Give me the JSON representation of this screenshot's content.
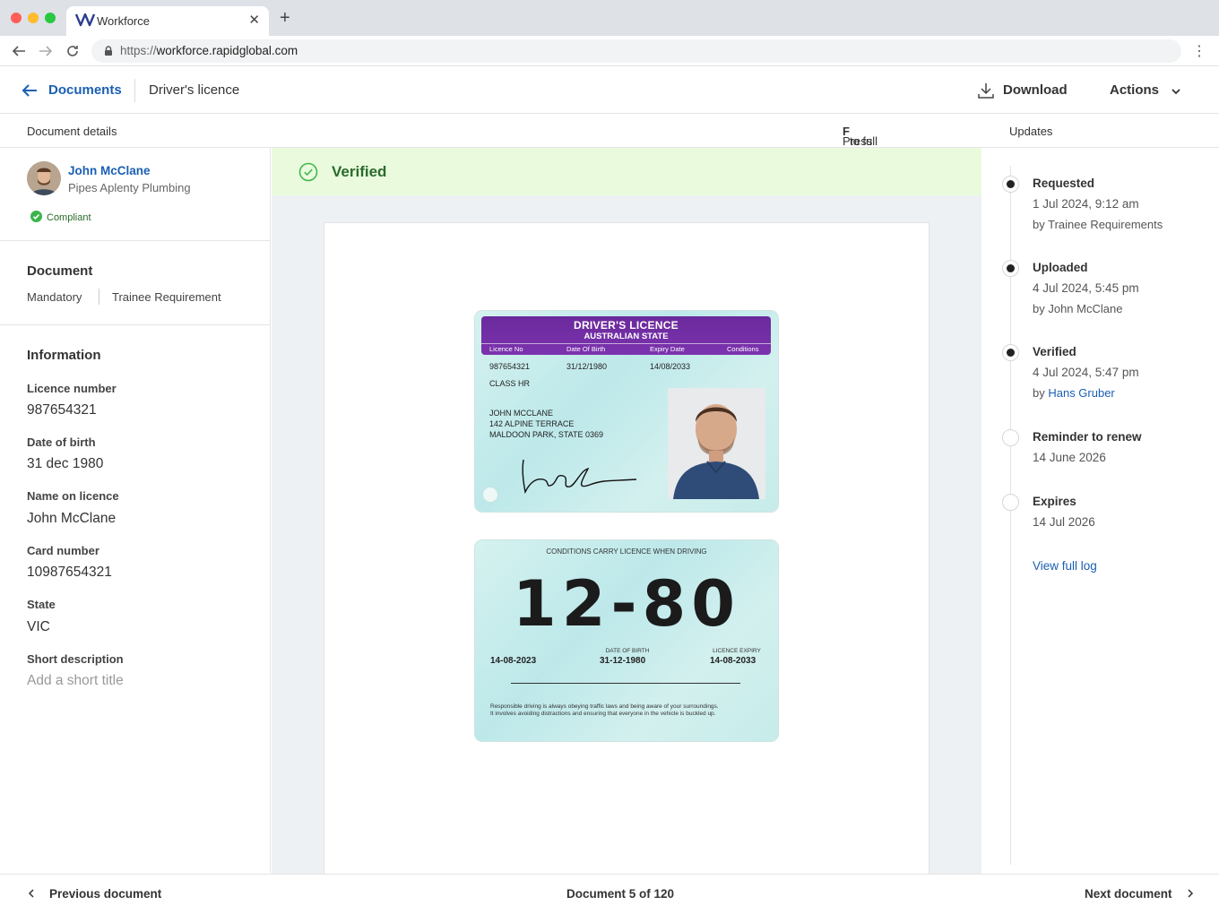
{
  "browser": {
    "tab_title": "Workforce",
    "url_proto": "https://",
    "url_host": "workforce.rapidglobal.com"
  },
  "header": {
    "back_label": "Documents",
    "current": "Driver's licence",
    "download_label": "Download",
    "actions_label": "Actions"
  },
  "subheader": {
    "left": "Document details",
    "hint_pre": "Press ",
    "hint_key": "F",
    "hint_post": " to full screen",
    "right": "Updates"
  },
  "person": {
    "name": "John McClane",
    "company": "Pipes Aplenty Plumbing",
    "status": "Compliant"
  },
  "document": {
    "title": "Document",
    "tag1": "Mandatory",
    "tag2": "Trainee Requirement"
  },
  "information": {
    "title": "Information",
    "fields": [
      {
        "label": "Licence number",
        "value": "987654321"
      },
      {
        "label": "Date of birth",
        "value": "31 dec 1980"
      },
      {
        "label": "Name on licence",
        "value": "John McClane"
      },
      {
        "label": "Card number",
        "value": "10987654321"
      },
      {
        "label": "State",
        "value": "VIC"
      },
      {
        "label": "Short description",
        "value": "Add a short title"
      }
    ]
  },
  "status_banner": "Verified",
  "card_front": {
    "title": "DRIVER'S LICENCE",
    "subtitle": "AUSTRALIAN STATE",
    "col_licence": "Licence No",
    "col_dob": "Date Of Birth",
    "col_expiry": "Expiry Date",
    "col_conditions": "Conditions",
    "licence_no": "987654321",
    "dob": "31/12/1980",
    "expiry": "14/08/2033",
    "class": "CLASS HR",
    "name": "JOHN MCCLANE",
    "address1": "142 ALPINE TERRACE",
    "address2": "MALDOON PARK, STATE 0369"
  },
  "card_back": {
    "header": "CONDITIONS CARRY LICENCE WHEN DRIVING",
    "big": "12-80",
    "issue": "14-08-2023",
    "dob_label": "DATE OF BIRTH",
    "dob": "31-12-1980",
    "expiry_label": "LICENCE EXPIRY",
    "expiry": "14-08-2033",
    "fine1": "Responsible driving is always obeying traffic laws and being aware of your surroundings.",
    "fine2": "It involves avoiding distractions and ensuring that everyone in the vehicle is buckled up."
  },
  "timeline": [
    {
      "title": "Requested",
      "date": "1 Jul 2024, 9:12 am",
      "by_prefix": "by ",
      "by": "Trainee Requirements",
      "filled": true
    },
    {
      "title": "Uploaded",
      "date": "4 Jul 2024, 5:45 pm",
      "by_prefix": "by ",
      "by": "John McClane",
      "filled": true
    },
    {
      "title": "Verified",
      "date": "4 Jul 2024, 5:47 pm",
      "by_prefix": "by ",
      "by": "Hans Gruber",
      "filled": true
    },
    {
      "title": "Reminder to renew",
      "date": "14 June 2026",
      "filled": false
    },
    {
      "title": "Expires",
      "date": "14 Jul 2026",
      "filled": false
    }
  ],
  "view_log": "View full log",
  "footer": {
    "prev": "Previous document",
    "position": "Document 5 of 120",
    "next": "Next document"
  },
  "colors": {
    "link": "#1a5fb4",
    "verified_bg": "#e9fbdc",
    "verified_text": "#2b6a2e",
    "card_header": "#7c33ae"
  }
}
